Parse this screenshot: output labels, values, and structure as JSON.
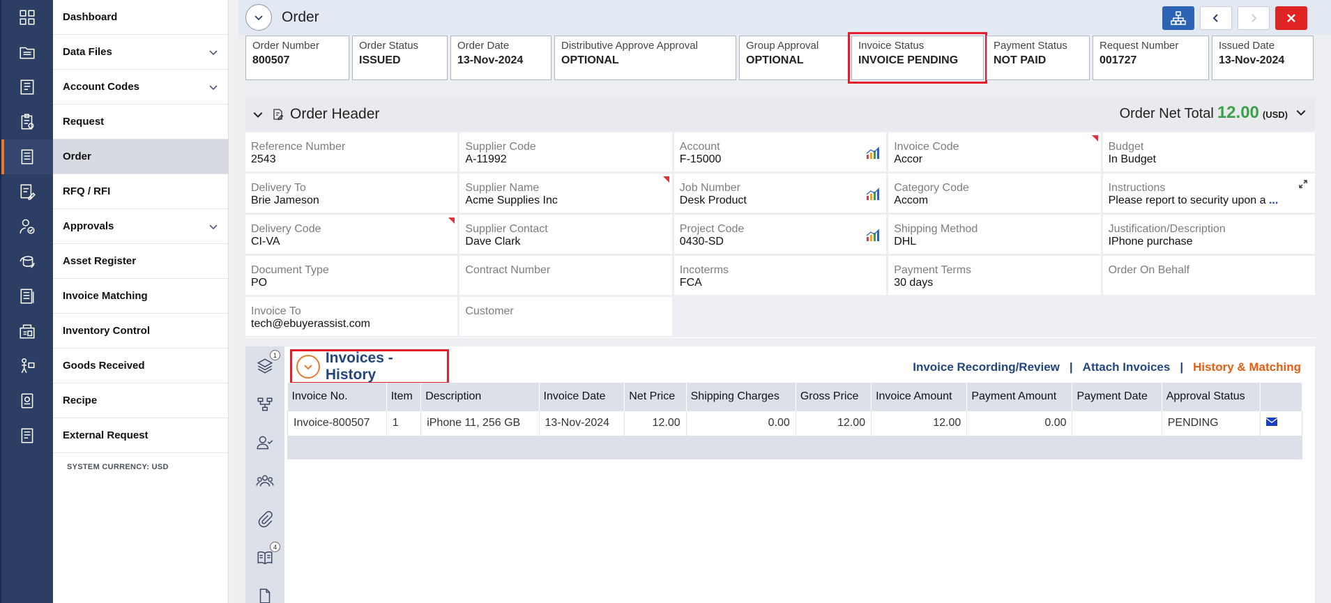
{
  "sidebar": {
    "items": [
      {
        "label": "Dashboard",
        "icon": "dashboard-icon",
        "has_chevron": false
      },
      {
        "label": "Data Files",
        "icon": "data-files-icon",
        "has_chevron": true
      },
      {
        "label": "Account Codes",
        "icon": "account-codes-icon",
        "has_chevron": true
      },
      {
        "label": "Request",
        "icon": "request-icon",
        "has_chevron": false
      },
      {
        "label": "Order",
        "icon": "order-icon",
        "has_chevron": false,
        "active": true
      },
      {
        "label": "RFQ / RFI",
        "icon": "rfq-icon",
        "has_chevron": false
      },
      {
        "label": "Approvals",
        "icon": "approvals-icon",
        "has_chevron": true
      },
      {
        "label": "Asset Register",
        "icon": "asset-register-icon",
        "has_chevron": false
      },
      {
        "label": "Invoice Matching",
        "icon": "invoice-matching-icon",
        "has_chevron": false
      },
      {
        "label": "Inventory Control",
        "icon": "inventory-control-icon",
        "has_chevron": false
      },
      {
        "label": "Goods Received",
        "icon": "goods-received-icon",
        "has_chevron": false
      },
      {
        "label": "Recipe",
        "icon": "recipe-icon",
        "has_chevron": false
      },
      {
        "label": "External Request",
        "icon": "external-request-icon",
        "has_chevron": false
      }
    ],
    "system_currency": "SYSTEM CURRENCY: USD"
  },
  "header": {
    "title": "Order"
  },
  "status_cards": [
    {
      "label": "Order Number",
      "value": "800507"
    },
    {
      "label": "Order Status",
      "value": "ISSUED"
    },
    {
      "label": "Order Date",
      "value": "13-Nov-2024"
    },
    {
      "label": "Distributive Approve Approval",
      "value": "OPTIONAL"
    },
    {
      "label": "Group Approval",
      "value": "OPTIONAL"
    },
    {
      "label": "Invoice Status",
      "value": "INVOICE PENDING"
    },
    {
      "label": "Payment Status",
      "value": "NOT PAID"
    },
    {
      "label": "Request Number",
      "value": "001727"
    },
    {
      "label": "Issued Date",
      "value": "13-Nov-2024"
    }
  ],
  "order_header": {
    "title": "Order Header",
    "net_total_label": "Order Net Total",
    "net_total_value": "12.00",
    "net_total_currency": "(USD)",
    "fields": [
      {
        "label": "Reference Number",
        "value": "2543"
      },
      {
        "label": "Supplier Code",
        "value": "A-11992"
      },
      {
        "label": "Account",
        "value": "F-15000"
      },
      {
        "label": "Invoice Code",
        "value": "Accor"
      },
      {
        "label": "Budget",
        "value": "In Budget"
      },
      {
        "label": "Delivery To",
        "value": "Brie Jameson"
      },
      {
        "label": "Supplier Name",
        "value": "Acme Supplies Inc"
      },
      {
        "label": "Job Number",
        "value": "Desk Product"
      },
      {
        "label": "Category Code",
        "value": "Accom"
      },
      {
        "label": "Instructions",
        "value": "Please report to security upon a",
        "more": "..."
      },
      {
        "label": "Delivery Code",
        "value": "CI-VA"
      },
      {
        "label": "Supplier Contact",
        "value": "Dave Clark"
      },
      {
        "label": "Project Code",
        "value": "0430-SD"
      },
      {
        "label": "Shipping Method",
        "value": "DHL"
      },
      {
        "label": "Justification/Description",
        "value": "IPhone purchase"
      },
      {
        "label": "Document Type",
        "value": "PO"
      },
      {
        "label": "Contract Number",
        "value": ""
      },
      {
        "label": "Incoterms",
        "value": "FCA"
      },
      {
        "label": "Payment Terms",
        "value": "30 days"
      },
      {
        "label": "Order On Behalf",
        "value": ""
      },
      {
        "label": "Invoice To",
        "value": "tech@ebuyerassist.com"
      },
      {
        "label": "Customer",
        "value": ""
      }
    ]
  },
  "invoices": {
    "title": "Invoices - History",
    "links": [
      "Invoice Recording/Review",
      "Attach Invoices",
      "History & Matching"
    ],
    "separator": "|",
    "tab_badges": {
      "layers": "1",
      "book": "4"
    },
    "columns": [
      "Invoice No.",
      "Item",
      "Description",
      "Invoice Date",
      "Net Price",
      "Shipping Charges",
      "Gross Price",
      "Invoice Amount",
      "Payment Amount",
      "Payment Date",
      "Approval Status"
    ],
    "rows": [
      [
        "Invoice-800507",
        "1",
        "iPhone 11, 256 GB",
        "13-Nov-2024",
        "12.00",
        "0.00",
        "12.00",
        "12.00",
        "0.00",
        "",
        "PENDING"
      ]
    ]
  },
  "colors": {
    "rail": "#2c3e63",
    "accent_orange": "#e87a2d",
    "highlight_red": "#e41e2b",
    "total_green": "#3aa04a",
    "link_blue": "#234680"
  }
}
